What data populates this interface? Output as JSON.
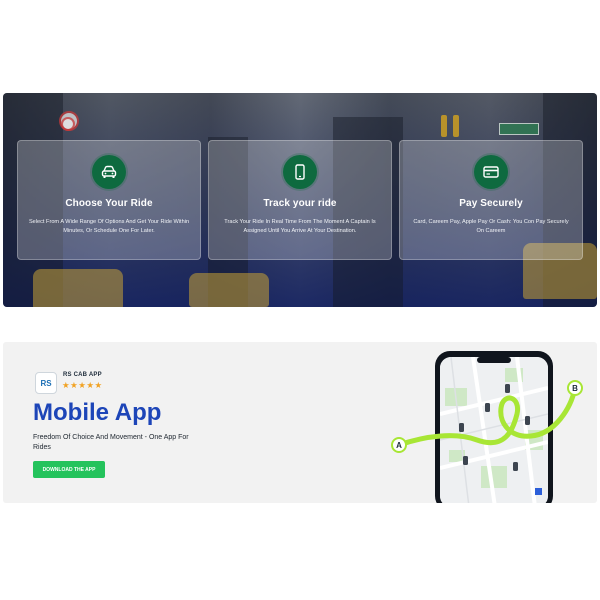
{
  "features": [
    {
      "title": "Choose Your Ride",
      "description": "Select From A Wide Range Of Options And Get Your Ride Within Minutes, Or Schedule One For Later.",
      "icon": "car-icon"
    },
    {
      "title": "Track your ride",
      "description": "Track Your Ride In Real Time From The Moment A Captain Is Assigned Until You Arrive At Your Destination.",
      "icon": "smartphone-icon"
    },
    {
      "title": "Pay Securely",
      "description": "Card, Careem Pay, Apple Pay Or Cash: You Con Pay Securely On Careem",
      "icon": "credit-card-icon"
    }
  ],
  "app": {
    "logo_text": "RS",
    "name": "RS CAB APP",
    "rating_stars": "★★★★★",
    "title": "Mobile App",
    "subtitle": "Freedom Of Choice And Movement - One App For Rides",
    "download_label": "DOWNLOAD THE APP",
    "map_point_a": "A",
    "map_point_b": "B"
  },
  "colors": {
    "accent_green": "#24c35c",
    "icon_green": "#0e6a3f",
    "title_blue": "#1d45b8",
    "star_orange": "#f1a223",
    "route_lime": "#a8e635"
  }
}
